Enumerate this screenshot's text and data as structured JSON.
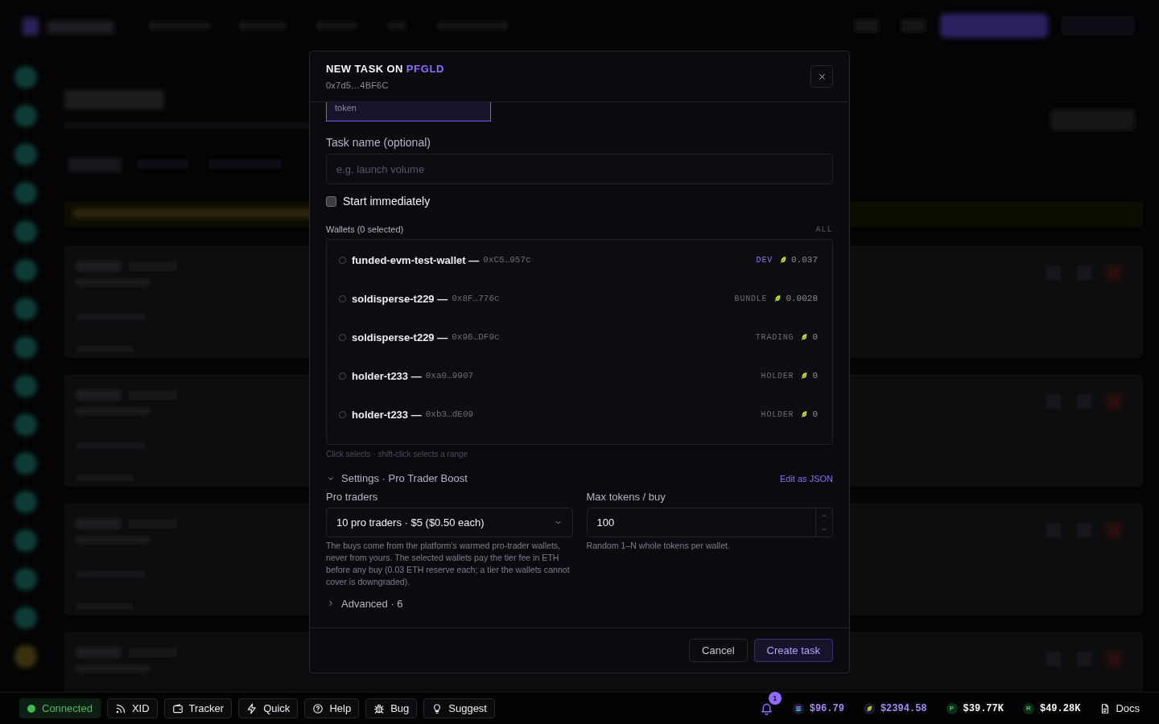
{
  "dialog": {
    "title": "NEW TASK ON",
    "token": "PFGLD",
    "address": "0x7d5…4BF6C"
  },
  "option_card": {
    "label": "token",
    "selected": true
  },
  "task_name": {
    "label": "Task name (optional)",
    "placeholder": "e.g. launch volume"
  },
  "start_immediately": {
    "label": "Start immediately",
    "checked": false
  },
  "wallets": {
    "label": "Wallets (0 selected)",
    "select_all": "ALL",
    "items": [
      {
        "name": "funded-evm-test-wallet —",
        "address": "0xC5…957c",
        "role": "DEV",
        "color": "#8b7cf6",
        "balance": "0.037",
        "selected": false
      },
      {
        "name": "soldisperse-t229 —",
        "address": "0x8F…776c",
        "role": "BUNDLE",
        "color": "#6b6b76",
        "balance": "0.0028",
        "selected": false
      },
      {
        "name": "soldisperse-t229 —",
        "address": "0x96…DF9c",
        "role": "TRADING",
        "color": "#6b6b76",
        "balance": "0",
        "selected": false
      },
      {
        "name": "holder-t233 —",
        "address": "0xa0…9907",
        "role": "HOLDER",
        "color": "#6b6b76",
        "balance": "0",
        "selected": false
      },
      {
        "name": "holder-t233 —",
        "address": "0xb3…dE09",
        "role": "HOLDER",
        "color": "#6b6b76",
        "balance": "0",
        "selected": false
      }
    ],
    "hint": "Click selects · shift-click selects a range"
  },
  "settings": {
    "label": "Settings · Pro Trader Boost",
    "expanded": true,
    "edit_link": "Edit as JSON",
    "fields": [
      {
        "kind": "select",
        "label": "Pro traders",
        "value": "10 pro traders · $5 ($0.50 each)",
        "help": "The buys come from the platform's warmed pro-trader wallets, never from yours. The selected wallets pay the tier fee in ETH before any buy (0.03 ETH reserve each; a tier the wallets cannot cover is downgraded)."
      },
      {
        "kind": "number",
        "label": "Max tokens / buy",
        "value": "100",
        "help": "Random 1–N whole tokens per wallet."
      }
    ]
  },
  "advanced": {
    "label": "Advanced · 6",
    "expanded": false
  },
  "footer_buttons": [
    {
      "label": "Cancel",
      "kind": "secondary"
    },
    {
      "label": "Create task",
      "kind": "primary"
    }
  ],
  "status_bar": {
    "connection": {
      "label": "Connected",
      "online": true
    },
    "buttons": [
      "XID",
      "Tracker",
      "Quick",
      "Help",
      "Bug",
      "Suggest"
    ],
    "notification_count": "1",
    "tickers": [
      {
        "kind": "coin",
        "value": "$96.79",
        "color": "#a78bfa"
      },
      {
        "kind": "coin",
        "value": "$2394.58",
        "color": "#a78bfa"
      },
      {
        "kind": "letter",
        "letter": "P",
        "value": "$39.77K",
        "color": "#f4f4f5"
      },
      {
        "kind": "letter",
        "letter": "R",
        "value": "$49.28K",
        "color": "#f4f4f5"
      }
    ],
    "docs_link": "Docs"
  }
}
